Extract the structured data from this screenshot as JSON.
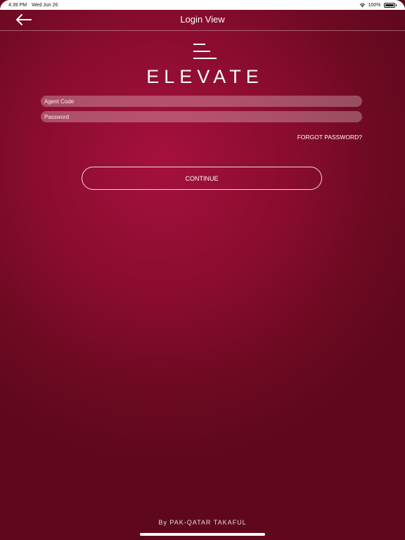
{
  "status_bar": {
    "time": "4:39 PM",
    "date": "Wed Jun 26",
    "battery": "100%",
    "wifi_icon": "wifi-icon",
    "battery_icon": "battery-icon"
  },
  "nav": {
    "title": "Login View",
    "back_icon": "arrow-left-icon"
  },
  "brand": {
    "name": "ELEVATE",
    "logo_icon": "elevate-lines-logo"
  },
  "form": {
    "agent_code": {
      "value": "",
      "placeholder": "Agent Code"
    },
    "password": {
      "value": "",
      "placeholder": "Password"
    },
    "forgot_label": "FORGOT PASSWORD?",
    "continue_label": "CONTINUE"
  },
  "footer": {
    "text": "By PAK-QATAR TAKAFUL"
  },
  "colors": {
    "background_primary": "#8a0c2f",
    "background_light": "#a5113d",
    "background_dark": "#5f081d",
    "text": "#ffffff"
  }
}
